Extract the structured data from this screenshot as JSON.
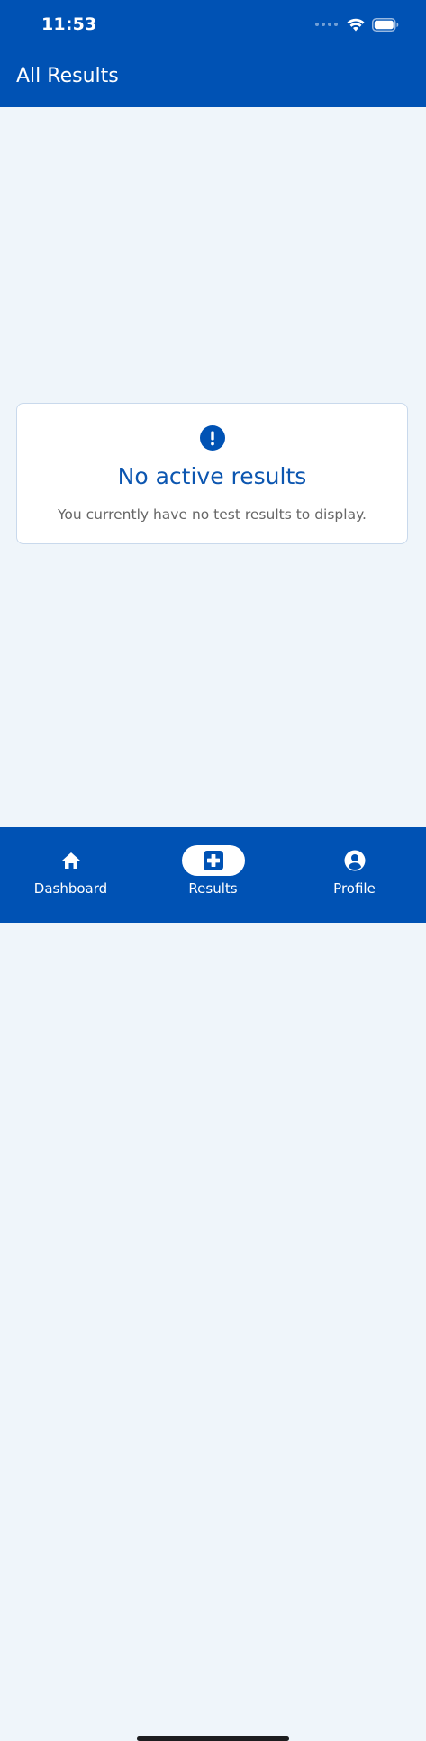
{
  "status_bar": {
    "time": "11:53"
  },
  "header": {
    "title": "All Results"
  },
  "empty_state": {
    "icon": "exclamation-circle-icon",
    "title": "No active results",
    "message": "You currently have no test results to display."
  },
  "bottom_nav": {
    "items": [
      {
        "label": "Dashboard",
        "icon": "home-icon",
        "active": false
      },
      {
        "label": "Results",
        "icon": "medical-plus-icon",
        "active": true
      },
      {
        "label": "Profile",
        "icon": "user-circle-icon",
        "active": false
      }
    ]
  },
  "colors": {
    "primary": "#0052b4",
    "background": "#eff5fa",
    "card": "#ffffff",
    "title_text": "#0c56b0",
    "body_text": "#666666"
  }
}
